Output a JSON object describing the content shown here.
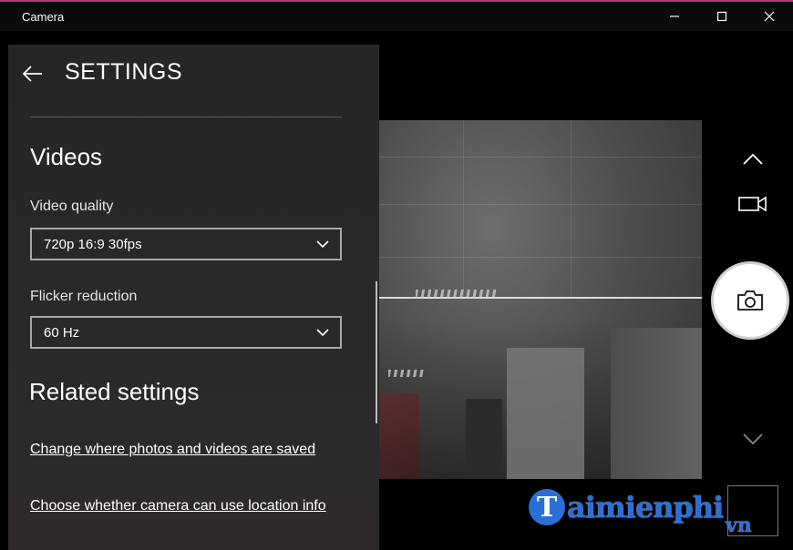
{
  "window": {
    "title": "Camera",
    "minimize_icon": "minimize-icon",
    "maximize_icon": "maximize-icon",
    "close_icon": "close-icon"
  },
  "settings": {
    "back_icon": "back-arrow-icon",
    "title": "SETTINGS",
    "videos_heading": "Videos",
    "video_quality": {
      "label": "Video quality",
      "selected": "720p 16:9 30fps"
    },
    "flicker_reduction": {
      "label": "Flicker reduction",
      "selected": "60 Hz"
    },
    "related_heading": "Related settings",
    "links": [
      "Change where photos and videos are saved",
      "Choose whether camera can use location info"
    ]
  },
  "controls": {
    "scroll_up_icon": "chevron-up-icon",
    "video_mode_icon": "video-camera-icon",
    "shutter_icon": "camera-icon",
    "scroll_down_icon": "chevron-down-icon"
  },
  "watermark": {
    "logo_letter": "T",
    "text": "aimienphi",
    "suffix": "vn"
  },
  "colors": {
    "accent_top": "#b23a6e",
    "panel_bg": "#262626",
    "watermark_blue": "#2b6fd6"
  }
}
